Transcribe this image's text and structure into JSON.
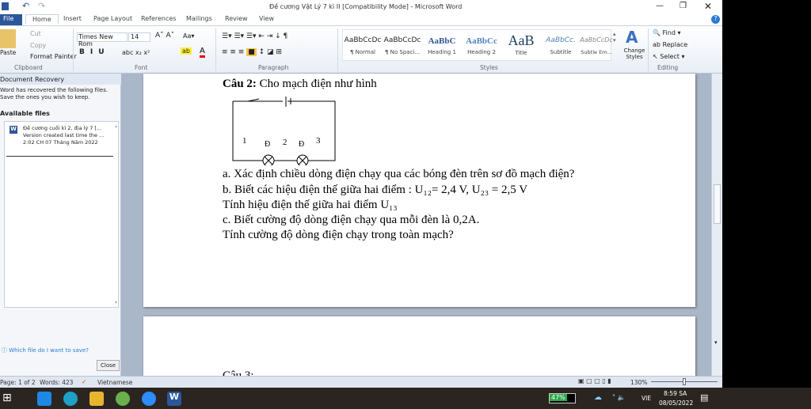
{
  "title": "Đề cương Vật Lý 7 kì II [Compatibility Mode]  -  Microsoft Word",
  "tabs": [
    "File",
    "Home",
    "Insert",
    "Page Layout",
    "References",
    "Mailings",
    "Review",
    "View"
  ],
  "clipboard": {
    "paste": "Paste",
    "cut": "Cut",
    "copy": "Copy",
    "format_painter": "Format Painter",
    "label": "Clipboard"
  },
  "font": {
    "name": "Times New Rom",
    "size": "14",
    "label": "Font"
  },
  "paragraph": {
    "label": "Paragraph"
  },
  "styles": {
    "items": [
      {
        "sample": "AaBbCcDc",
        "name": "¶ Normal"
      },
      {
        "sample": "AaBbCcDc",
        "name": "¶ No Spaci..."
      },
      {
        "sample": "AaBbC",
        "name": "Heading 1"
      },
      {
        "sample": "AaBbCc",
        "name": "Heading 2"
      },
      {
        "sample": "AaB",
        "name": "Title"
      },
      {
        "sample": "AaBbCc.",
        "name": "Subtitle"
      },
      {
        "sample": "AaBbCcDc",
        "name": "Subtle Em..."
      }
    ],
    "change": "Change Styles",
    "label": "Styles"
  },
  "editing": {
    "find": "Find",
    "replace": "Replace",
    "select": "Select",
    "label": "Editing"
  },
  "recovery": {
    "title": "Document Recovery",
    "desc": "Word has recovered the following files.  Save the ones you wish to keep.",
    "available": "Available files",
    "file_name": "Đề cương cuối kì 2, địa lý 7  [...",
    "file_desc": "Version created last time the ...",
    "file_time": "2:02 CH 07 Tháng Năm 2022",
    "help": "Which file do I want to save?",
    "close": "Close"
  },
  "doc": {
    "heading_bold": "Câu 2:",
    "heading_rest": " Cho mạch điện như hình",
    "lines": [
      "a. Xác định chiều dòng điện chạy qua các bóng đèn trên sơ đồ mạch điện?",
      "b. Biết các hiệu điện thế giữa hai điểm : U₁₂= 2,4 V, U₂₃ = 2,5 V",
      "Tính hiệu điện thế giữa hai điểm U₁₃",
      "c. Biết cường độ dòng điện chạy qua mỗi đèn là 0,2A.",
      "Tính cường độ dòng điện chạy trong toàn mạch?"
    ],
    "circuit": {
      "p1": "1",
      "p2": "2",
      "p3": "3",
      "lamp": "Đ"
    },
    "next": "Câu 3:"
  },
  "status": {
    "page": "Page: 1 of 2",
    "words": "Words: 423",
    "lang": "Vietnamese",
    "zoom": "130%"
  },
  "taskbar": {
    "battery": "47%",
    "ime": "VIE",
    "time": "8:59 SA",
    "date": "08/05/2022"
  }
}
